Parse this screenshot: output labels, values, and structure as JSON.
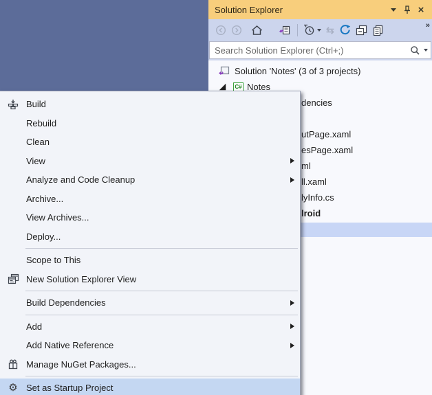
{
  "panel": {
    "title": "Solution Explorer",
    "toolbar_icons": [
      "back-icon",
      "forward-icon",
      "home-icon",
      "sync-with-active-document-icon",
      "timeline-filter-icon",
      "switch-views-icon",
      "refresh-icon",
      "collapse-all-icon",
      "preview-selected-items-icon",
      "overflow-chevron-icon"
    ],
    "search": {
      "placeholder": "Search Solution Explorer (Ctrl+;)"
    }
  },
  "tree": {
    "solution_label": "Solution 'Notes' (3 of 3 projects)",
    "project_label": "Notes",
    "project_badge": "C#",
    "remnants": [
      "dencies",
      "utPage.xaml",
      "esPage.xaml",
      "ml",
      "ll.xaml",
      "lyInfo.cs",
      "lroid"
    ]
  },
  "menu": {
    "items": [
      {
        "label": "Build",
        "icon": "build-icon"
      },
      {
        "label": "Rebuild"
      },
      {
        "label": "Clean"
      },
      {
        "label": "View",
        "submenu": true
      },
      {
        "label": "Analyze and Code Cleanup",
        "submenu": true
      },
      {
        "label": "Archive..."
      },
      {
        "label": "View Archives..."
      },
      {
        "label": "Deploy..."
      },
      {
        "label": "Scope to This"
      },
      {
        "label": "New Solution Explorer View",
        "icon": "new-solution-explorer-view-icon"
      },
      {
        "label": "Build Dependencies",
        "submenu": true
      },
      {
        "label": "Add",
        "submenu": true
      },
      {
        "label": "Add Native Reference",
        "submenu": true
      },
      {
        "label": "Manage NuGet Packages...",
        "icon": "nuget-package-icon"
      },
      {
        "label": "Set as Startup Project",
        "icon": "gear-icon",
        "highlighted": true
      }
    ]
  },
  "icons": {
    "close": "×",
    "overflow": "»",
    "switch": "⇆",
    "gear": "⚙"
  },
  "colors": {
    "backdrop": "#5C6C99",
    "titlebar_gold": "#F8CE7C",
    "toolbar_bg": "#CCD5ED",
    "tree_bg": "#F8F9FD",
    "menu_bg": "#F2F4F9",
    "menu_highlight": "#C4D7F2",
    "tree_selection": "#C8D6F6",
    "refresh_blue": "#1878C2",
    "solution_purple": "#8B3EC0",
    "csharp_green": "#3BA23B"
  }
}
